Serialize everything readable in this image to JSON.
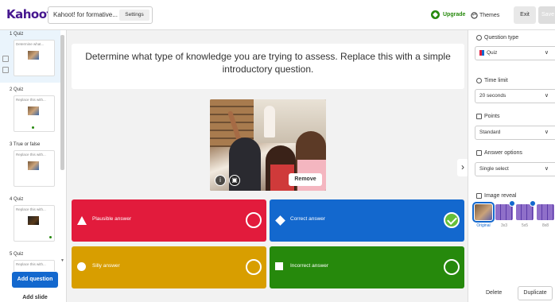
{
  "app": {
    "logo": "Kahoot!",
    "title": "Kahoot! for formative...",
    "settings_label": "Settings",
    "upgrade_label": "Upgrade",
    "themes_label": "Themes",
    "exit_label": "Exit",
    "save_label": "Save"
  },
  "sidebar": {
    "slides": [
      {
        "label": "1 Quiz",
        "thumb_text": "Determine what...",
        "active": true
      },
      {
        "label": "2 Quiz",
        "thumb_text": "Replace this with...",
        "active": false
      },
      {
        "label": "3 True or false",
        "thumb_text": "Replace this with...",
        "active": false
      },
      {
        "label": "4 Quiz",
        "thumb_text": "Replace this with...",
        "active": false
      },
      {
        "label": "5 Quiz",
        "thumb_text": "Replace this with...",
        "active": false
      }
    ],
    "add_question_label": "Add question",
    "add_slide_label": "Add slide"
  },
  "question": {
    "text": "Determine what type of knowledge you are trying to assess. Replace this with a simple introductory question.",
    "remove_label": "Remove"
  },
  "answers": [
    {
      "text": "Plausible answer",
      "color": "#e21b3c",
      "shape": "triangle",
      "correct": false
    },
    {
      "text": "Correct answer",
      "color": "#1368ce",
      "shape": "diamond",
      "correct": true
    },
    {
      "text": "Silly answer",
      "color": "#d89e00",
      "shape": "circle",
      "correct": false
    },
    {
      "text": "Incorrect answer",
      "color": "#26890c",
      "shape": "square",
      "correct": false
    }
  ],
  "panel": {
    "question_type_title": "Question type",
    "question_type_value": "Quiz",
    "time_limit_title": "Time limit",
    "time_limit_value": "20 seconds",
    "points_title": "Points",
    "points_value": "Standard",
    "answer_options_title": "Answer options",
    "answer_options_value": "Single select",
    "image_reveal_title": "Image reveal",
    "image_reveal_options": [
      "Original",
      "3x3",
      "5x5",
      "8x8"
    ],
    "image_reveal_selected": "Original",
    "delete_label": "Delete",
    "duplicate_label": "Duplicate"
  }
}
